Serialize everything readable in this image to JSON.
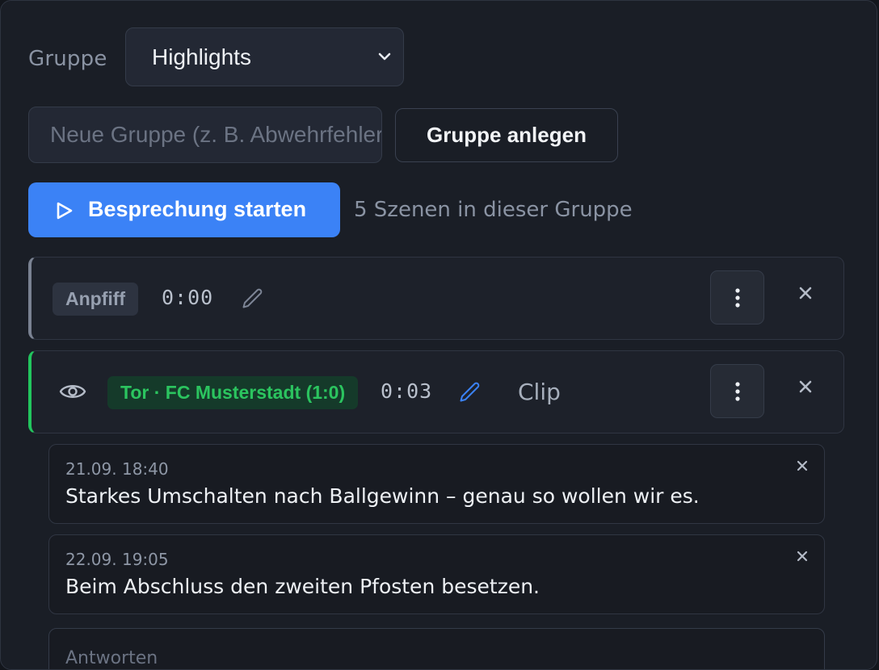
{
  "group": {
    "label": "Gruppe",
    "selected": "Highlights",
    "new_placeholder": "Neue Gruppe (z. B. Abwehrfehler)",
    "create_label": "Gruppe anlegen"
  },
  "session": {
    "start_label": "Besprechung starten",
    "count_text": "5 Szenen in dieser Gruppe"
  },
  "scenes": [
    {
      "tag": "Anpfiff",
      "time": "0:00",
      "clip_label": ""
    },
    {
      "tag": "Tor · FC Musterstadt (1:0)",
      "time": "0:03",
      "clip_label": "Clip"
    }
  ],
  "comments": [
    {
      "date": "21.09. 18:40",
      "text": "Starkes Umschalten nach Ballgewinn – genau so wollen wir es."
    },
    {
      "date": "22.09. 19:05",
      "text": "Beim Abschluss den zweiten Pfosten besetzen."
    }
  ],
  "reply": {
    "placeholder": "Antworten"
  },
  "colors": {
    "accent": "#3b82f6",
    "goal": "#22c55e",
    "neutral_marker": "#7a8292",
    "background": "#1a1e26"
  },
  "icons": [
    "chevron-down-icon",
    "play-icon",
    "pencil-icon",
    "eye-icon",
    "more-vertical-icon",
    "close-icon"
  ]
}
